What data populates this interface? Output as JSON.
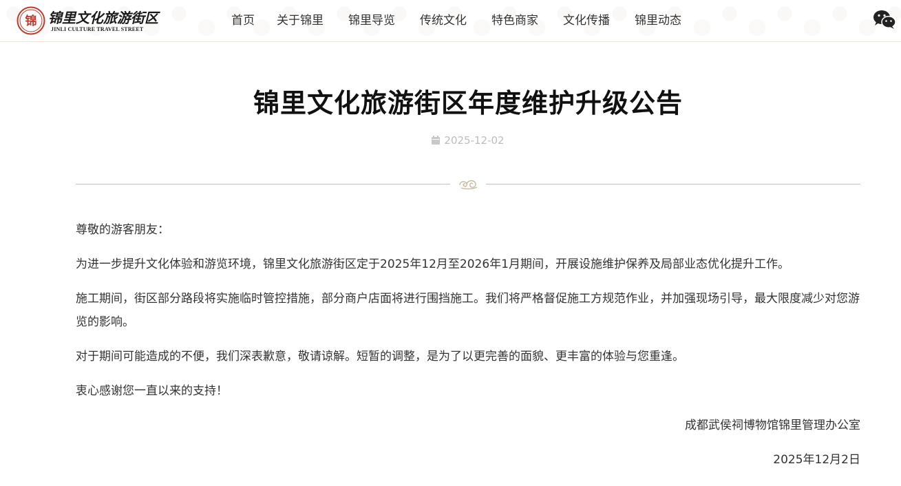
{
  "header": {
    "logo": {
      "cn_text": "锦里文化旅游街区",
      "en_text": "JINLI CULTURE TRAVEL STREET",
      "seal_text": "锦",
      "brand_color": "#c0392b"
    },
    "nav": [
      {
        "label": "首页"
      },
      {
        "label": "关于锦里"
      },
      {
        "label": "锦里导览"
      },
      {
        "label": "传统文化"
      },
      {
        "label": "特色商家"
      },
      {
        "label": "文化传播"
      },
      {
        "label": "锦里动态"
      }
    ],
    "wechat_icon": "wechat-icon"
  },
  "article": {
    "title": "锦里文化旅游街区年度维护升级公告",
    "date": "2025-12-02",
    "date_icon": "calendar-icon",
    "ornament_icon": "cloud-ornament-icon",
    "paragraphs": [
      "尊敬的游客朋友：",
      "为进一步提升文化体验和游览环境，锦里文化旅游街区定于2025年12月至2026年1月期间，开展设施维护保养及局部业态优化提升工作。",
      "施工期间，街区部分路段将实施临时管控措施，部分商户店面将进行围挡施工。我们将严格督促施工方规范作业，并加强现场引导，最大限度减少对您游览的影响。",
      "对于期间可能造成的不便，我们深表歉意，敬请谅解。短暂的调整，是为了以更完善的面貌、更丰富的体验与您重逢。",
      "衷心感谢您一直以来的支持！"
    ],
    "signature": "成都武侯祠博物馆锦里管理办公室",
    "signature_date": "2025年12月2日"
  },
  "colors": {
    "divider": "#cdbfa8",
    "date_text": "#bdbdbd",
    "title_text": "#111111"
  }
}
